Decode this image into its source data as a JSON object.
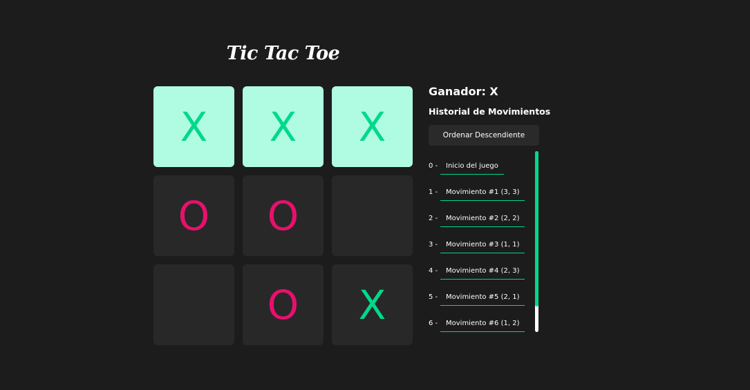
{
  "title": "Tic Tac Toe",
  "board": {
    "cells": [
      {
        "mark": "X",
        "win": true
      },
      {
        "mark": "X",
        "win": true
      },
      {
        "mark": "X",
        "win": true
      },
      {
        "mark": "O",
        "win": false
      },
      {
        "mark": "O",
        "win": false
      },
      {
        "mark": "",
        "win": false
      },
      {
        "mark": "",
        "win": false
      },
      {
        "mark": "O",
        "win": false
      },
      {
        "mark": "X",
        "win": false
      }
    ]
  },
  "side": {
    "status": "Ganador: X",
    "history_title": "Historial de Movimientos",
    "sort_label": "Ordenar Descendiente"
  },
  "moves": [
    {
      "index": "0 -",
      "label": "Inicio del juego"
    },
    {
      "index": "1 -",
      "label": "Movimiento #1 (3, 3)"
    },
    {
      "index": "2 -",
      "label": "Movimiento #2 (2, 2)"
    },
    {
      "index": "3 -",
      "label": "Movimiento #3 (1, 1)"
    },
    {
      "index": "4 -",
      "label": "Movimiento #4 (2, 3)"
    },
    {
      "index": "5 -",
      "label": "Movimiento #5 (2, 1)"
    },
    {
      "index": "6 -",
      "label": "Movimiento #6 (1, 2)"
    }
  ],
  "scroll": {
    "visible_fraction": 0.86
  },
  "colors": {
    "background": "#1c1c1c",
    "cell": "#282828",
    "win_cell": "#b0fce3",
    "x_mark": "#00d98b",
    "o_mark": "#e8106d",
    "accent": "#00d98b"
  }
}
